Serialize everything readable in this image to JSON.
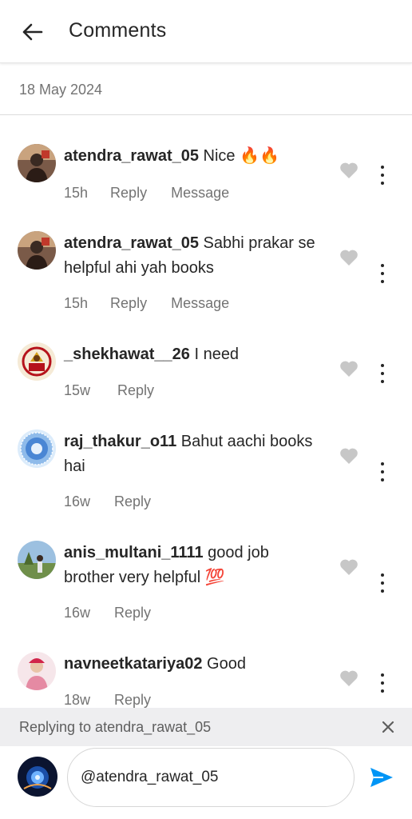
{
  "header": {
    "title": "Comments",
    "back_icon": "arrow-left-icon"
  },
  "date_label": "18 May 2024",
  "comments": [
    {
      "username": "atendra_rawat_05",
      "text": "Nice 🔥🔥",
      "time": "15h",
      "reply_label": "Reply",
      "message_label": "Message",
      "avatar_colors": [
        "#6b4a3a",
        "#c0392b"
      ]
    },
    {
      "username": "atendra_rawat_05",
      "text": "Sabhi prakar se helpful ahi yah books",
      "time": "15h",
      "reply_label": "Reply",
      "message_label": "Message",
      "avatar_colors": [
        "#6b4a3a",
        "#c0392b"
      ]
    },
    {
      "username": "_shekhawat__26",
      "text": "I need",
      "time": "15w",
      "reply_label": "Reply",
      "avatar_colors": [
        "#f3e3c4",
        "#b5121b"
      ]
    },
    {
      "username": "raj_thakur_o11",
      "text": "Bahut aachi books hai",
      "time": "16w",
      "reply_label": "Reply",
      "avatar_colors": [
        "#3b74c6",
        "#9bc3f0"
      ]
    },
    {
      "username": "anis_multani_1111",
      "text": "good job brother very helpful 💯",
      "time": "16w",
      "reply_label": "Reply",
      "avatar_colors": [
        "#8fb3d8",
        "#5a7a3a"
      ]
    },
    {
      "username": "navneetkatariya02",
      "text": "Good",
      "time": "18w",
      "reply_label": "Reply",
      "avatar_colors": [
        "#f2d6dc",
        "#d1254a"
      ]
    }
  ],
  "reply_bar": {
    "text": "Replying to atendra_rawat_05"
  },
  "composer": {
    "value": "@atendra_rawat_05",
    "send_icon": "send-icon",
    "accent": "#0095f6"
  }
}
